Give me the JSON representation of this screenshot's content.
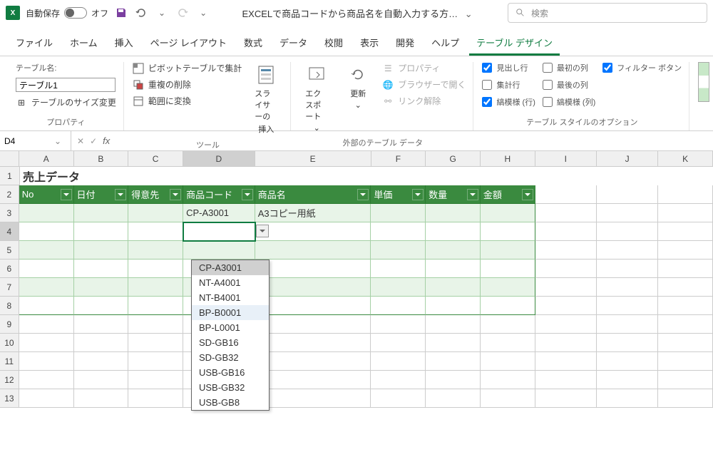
{
  "titlebar": {
    "autosave_label": "自動保存",
    "autosave_state": "オフ",
    "doc_title": "EXCELで商品コードから商品名を自動入力する方…",
    "search_placeholder": "検索"
  },
  "tabs": {
    "file": "ファイル",
    "home": "ホーム",
    "insert": "挿入",
    "pagelayout": "ページ レイアウト",
    "formulas": "数式",
    "data": "データ",
    "review": "校閲",
    "view": "表示",
    "developer": "開発",
    "help": "ヘルプ",
    "tabledesign": "テーブル デザイン"
  },
  "ribbon": {
    "properties": {
      "tablename_label": "テーブル名:",
      "tablename_value": "テーブル1",
      "resize": "テーブルのサイズ変更",
      "group_label": "プロパティ"
    },
    "tools": {
      "pivot": "ピボットテーブルで集計",
      "dedup": "重複の削除",
      "convert": "範囲に変換",
      "slicer_top": "スライサーの",
      "slicer_bottom": "挿入",
      "group_label": "ツール"
    },
    "external": {
      "export": "エクスポート",
      "refresh": "更新",
      "props": "プロパティ",
      "browser": "ブラウザーで開く",
      "unlink": "リンク解除",
      "group_label": "外部のテーブル データ"
    },
    "options": {
      "header_row": "見出し行",
      "total_row": "集計行",
      "banded_rows": "縞模様 (行)",
      "first_col": "最初の列",
      "last_col": "最後の列",
      "banded_cols": "縞模様 (列)",
      "filter_btn": "フィルター ボタン",
      "group_label": "テーブル スタイルのオプション"
    }
  },
  "formula_bar": {
    "name_box": "D4"
  },
  "columns": [
    "A",
    "B",
    "C",
    "D",
    "E",
    "F",
    "G",
    "H",
    "I",
    "J",
    "K"
  ],
  "sheet": {
    "title": "売上データ",
    "headers": {
      "no": "No",
      "date": "日付",
      "customer": "得意先",
      "code": "商品コード",
      "name": "商品名",
      "price": "単価",
      "qty": "数量",
      "amount": "金額"
    },
    "row3": {
      "code": "CP-A3001",
      "name": "A3コピー用紙"
    },
    "dropdown_items": [
      "CP-A3001",
      "NT-A4001",
      "NT-B4001",
      "BP-B0001",
      "BP-L0001",
      "SD-GB16",
      "SD-GB32",
      "USB-GB16",
      "USB-GB32",
      "USB-GB8"
    ]
  }
}
